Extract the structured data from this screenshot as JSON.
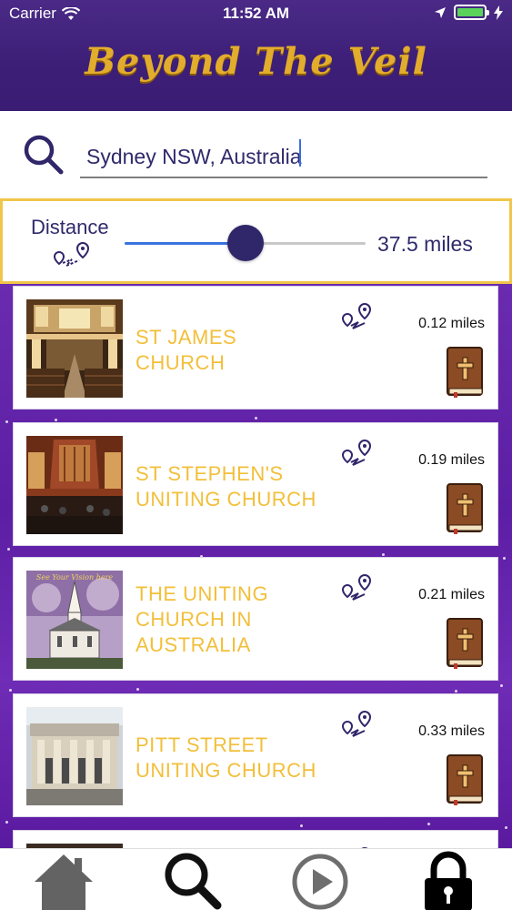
{
  "status_bar": {
    "carrier": "Carrier",
    "time": "11:52 AM"
  },
  "header": {
    "title": "Beyond The Veil"
  },
  "search": {
    "value": "Sydney NSW, Australia"
  },
  "distance": {
    "label": "Distance",
    "value_text": "37.5 miles",
    "slider_fraction": 0.5
  },
  "churches": [
    {
      "name": "ST JAMES CHURCH",
      "name_lines": [
        "ST JAMES",
        "CHURCH"
      ],
      "distance": "0.12 miles"
    },
    {
      "name": "ST STEPHEN'S UNITING CHURCH",
      "name_lines": [
        "ST STEPHEN'S",
        "UNITING CHURCH"
      ],
      "distance": "0.19 miles"
    },
    {
      "name": "THE UNITING CHURCH IN AUSTRALIA",
      "name_lines": [
        "THE UNITING",
        "CHURCH IN",
        "AUSTRALIA"
      ],
      "distance": "0.21 miles",
      "image_caption": "See Your Vision here"
    },
    {
      "name": "PITT STREET UNITING CHURCH",
      "name_lines": [
        "PITT STREET",
        "UNITING CHURCH"
      ],
      "distance": "0.33 miles"
    }
  ],
  "tabbar": {
    "items": [
      "home-icon",
      "search-icon",
      "play-icon",
      "lock-icon"
    ],
    "active": "search"
  },
  "colors": {
    "header_purple": "#3d1f78",
    "gold": "#f2bf3a",
    "accent_blue": "#3a73e0",
    "thumb": "#30266a",
    "card_border_gold": "#f0c64a"
  }
}
